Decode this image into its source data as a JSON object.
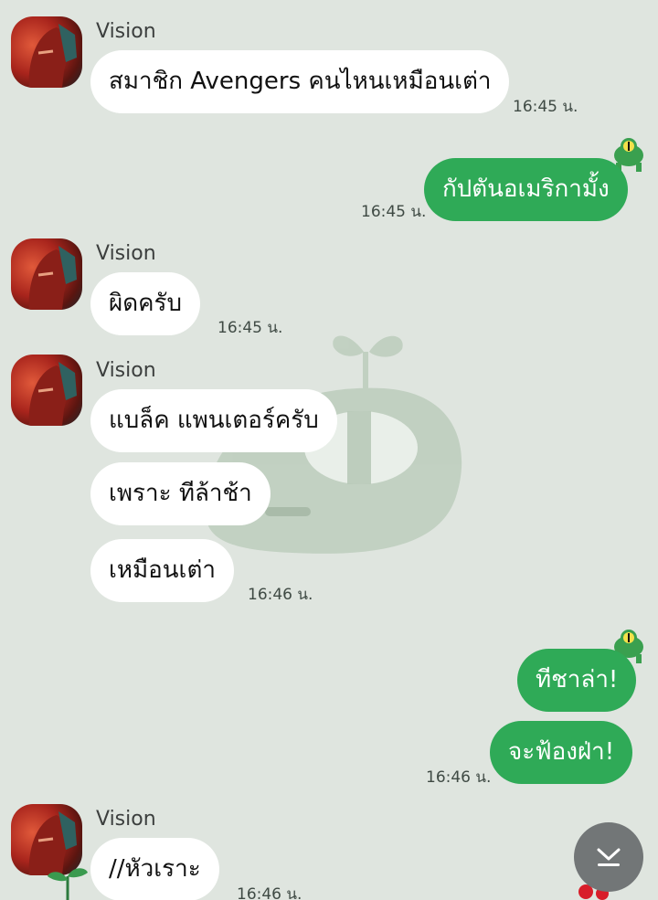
{
  "messages": [
    {
      "sender": "Vision",
      "text": "สมาชิก Avengers คนไหนเหมือนเต่า",
      "time": "16:45 น."
    },
    {
      "text": "กัปตันอเมริกามั้ง",
      "time": "16:45 น."
    },
    {
      "sender": "Vision",
      "text": "ผิดครับ",
      "time": "16:45 น."
    },
    {
      "sender": "Vision",
      "text": "แบล็ค แพนเตอร์ครับ"
    },
    {
      "text": "เพราะ ทีล้าช้า"
    },
    {
      "text": "เหมือนเต่า",
      "time": "16:46 น."
    },
    {
      "text": "ทีชาล่า!"
    },
    {
      "text": "จะฟ้องฝ่า!",
      "time": "16:46 น."
    },
    {
      "sender": "Vision",
      "text": "//หัวเราะ",
      "time": "16:46 น."
    }
  ],
  "colors": {
    "outgoing_bubble": "#2faa57",
    "incoming_bubble": "#ffffff",
    "background": "#dfe5df"
  },
  "icons": {
    "scroll_down": "chevron-down-icon",
    "sticker": "frog-icon",
    "avatar": "vision-avatar"
  }
}
